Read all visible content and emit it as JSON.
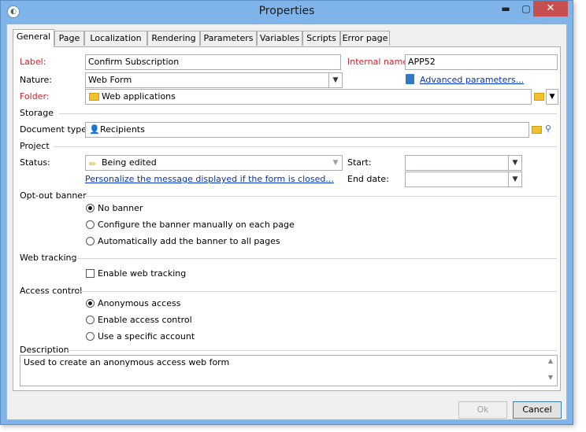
{
  "window": {
    "title": "Properties",
    "minimize": "▬",
    "maximize": "▢",
    "close": "✕"
  },
  "tabs": [
    "General",
    "Page",
    "Localization",
    "Rendering",
    "Parameters",
    "Variables",
    "Scripts",
    "Error page"
  ],
  "form": {
    "label_label": "Label:",
    "label_value": "Confirm Subscription",
    "internal_name_label": "Internal name:",
    "internal_name_value": "APP52",
    "nature_label": "Nature:",
    "nature_value": "Web Form",
    "advanced_parameters": "Advanced parameters...",
    "folder_label": "Folder:",
    "folder_value": "Web applications",
    "storage_section": "Storage",
    "document_type_label": "Document type:",
    "document_type_value": "Recipients",
    "project_section": "Project",
    "status_label": "Status:",
    "status_value": "Being edited",
    "start_label": "Start:",
    "end_date_label": "End date:",
    "start_value": "",
    "end_date_value": "",
    "personalize_link": "Personalize the message displayed if the form is closed...",
    "optout_section": "Opt-out banner",
    "optout_options": [
      "No banner",
      "Configure the banner manually on each page",
      "Automatically add the banner to all pages"
    ],
    "optout_selected": 0,
    "webtracking_section": "Web tracking",
    "enable_web_tracking": "Enable web tracking",
    "enable_web_tracking_checked": false,
    "access_section": "Access control",
    "access_options": [
      "Anonymous access",
      "Enable access control",
      "Use a specific account"
    ],
    "access_selected": 0,
    "description_section": "Description",
    "description_value": "Used to create an anonymous access web form"
  },
  "buttons": {
    "ok": "Ok",
    "cancel": "Cancel"
  },
  "colors": {
    "label_required": "#d4202a",
    "link": "#0033cc",
    "titlebar": "#7eb4ea",
    "close": "#c74f50"
  }
}
